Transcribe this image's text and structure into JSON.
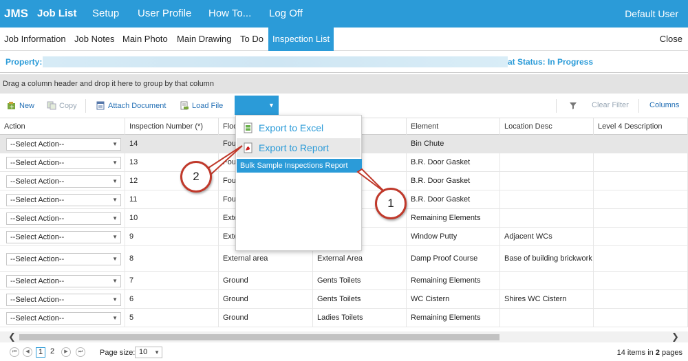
{
  "app": {
    "brand": "JMS",
    "nav": [
      "Job List",
      "Setup",
      "User Profile",
      "How To...",
      "Log Off"
    ],
    "user": "Default User"
  },
  "tabs": [
    "Job Information",
    "Job Notes",
    "Main Photo",
    "Main Drawing",
    "To Do",
    "Inspection List"
  ],
  "close_label": "Close",
  "property": {
    "label": "Property:",
    "status": "at Status: In Progress"
  },
  "group_hint": "Drag a column header and drop it here to group by that column",
  "toolbar": {
    "new": "New",
    "copy": "Copy",
    "attach": "Attach Document",
    "load": "Load File",
    "clear_filter": "Clear Filter",
    "columns": "Columns"
  },
  "columns": [
    "Action",
    "Inspection Number (*)",
    "Floo",
    "",
    "Element",
    "Location Desc",
    "Level 4 Description"
  ],
  "action_placeholder": "--Select Action--",
  "rows": [
    {
      "num": "14",
      "floor": "Fou",
      "room": "",
      "element": "Bin Chute",
      "loc": ""
    },
    {
      "num": "13",
      "floor": "Fou",
      "room": "",
      "element": "B.R. Door Gasket",
      "loc": ""
    },
    {
      "num": "12",
      "floor": "Fou",
      "room": "",
      "element": "B.R. Door Gasket",
      "loc": ""
    },
    {
      "num": "11",
      "floor": "Fou",
      "room": "",
      "element": "B.R. Door Gasket",
      "loc": ""
    },
    {
      "num": "10",
      "floor": "Exte",
      "room": "",
      "element": "Remaining Elements",
      "loc": ""
    },
    {
      "num": "9",
      "floor": "Exte",
      "room": "",
      "element": "Window Putty",
      "loc": "Adjacent WCs"
    },
    {
      "num": "8",
      "floor": "External area",
      "room": "External Area",
      "element": "Damp Proof Course",
      "loc": "Base of building brickwork"
    },
    {
      "num": "7",
      "floor": "Ground",
      "room": "Gents Toilets",
      "element": "Remaining Elements",
      "loc": ""
    },
    {
      "num": "6",
      "floor": "Ground",
      "room": "Gents Toilets",
      "element": "WC Cistern",
      "loc": "Shires WC Cistern"
    },
    {
      "num": "5",
      "floor": "Ground",
      "room": "Ladies Toilets",
      "element": "Remaining Elements",
      "loc": ""
    }
  ],
  "menu": {
    "excel": "Export to Excel",
    "report": "Export to Report",
    "sub": "Bulk Sample Inspections Report"
  },
  "callouts": [
    "1",
    "2"
  ],
  "pager": {
    "pages": [
      "1",
      "2"
    ],
    "size_label": "Page size:",
    "size": "10",
    "info_pre": "14 items in ",
    "info_pages": "2",
    "info_post": " pages"
  },
  "colors": {
    "accent": "#2b9bd8",
    "callout_border": "#c0392b"
  }
}
